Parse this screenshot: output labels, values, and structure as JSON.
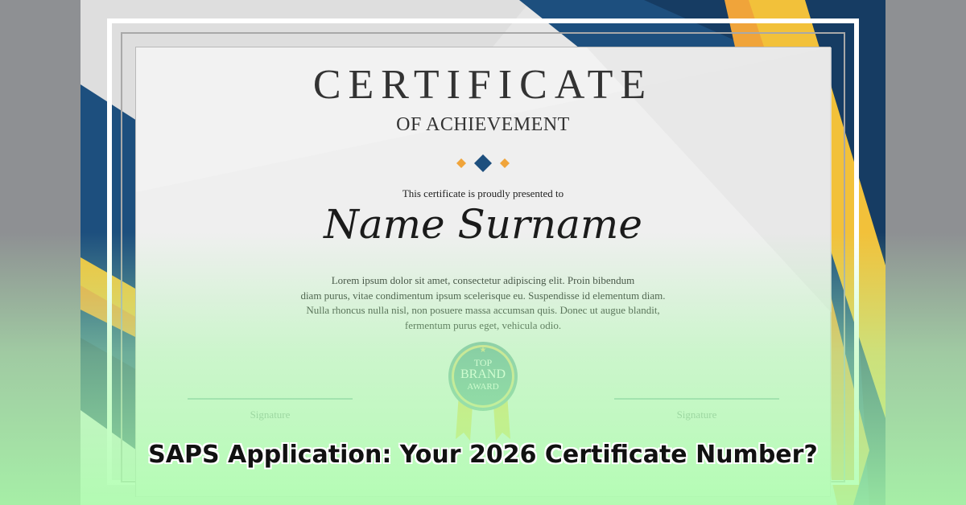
{
  "certificate": {
    "title": "CERTIFICATE",
    "subtitle": "OF ACHIEVEMENT",
    "presented_text": "This certificate is proudly presented to",
    "recipient_name": "Name Surname",
    "body_lines": [
      "Lorem ipsum dolor sit amet, consectetur adipiscing elit. Proin bibendum",
      "diam purus, vitae condimentum ipsum scelerisque eu. Suspendisse id elementum diam.",
      "Nulla rhoncus nulla nisl, non posuere massa accumsan quis. Donec ut augue blandit,",
      "fermentum purus eget, vehicula odio."
    ],
    "signature_left": "Signature",
    "signature_right": "Signature",
    "badge": {
      "line1": "TOP",
      "line2": "BRAND",
      "line3": "AWARD",
      "star": "★"
    }
  },
  "headline": "SAPS Application: Your 2026 Certificate Number?",
  "colors": {
    "navy": "#1d4f7e",
    "dark_navy": "#163c63",
    "gold": "#f2c13a",
    "orange": "#f0a43a",
    "teal_badge": "#5c9e98",
    "badge_ring": "#e8d37a"
  }
}
